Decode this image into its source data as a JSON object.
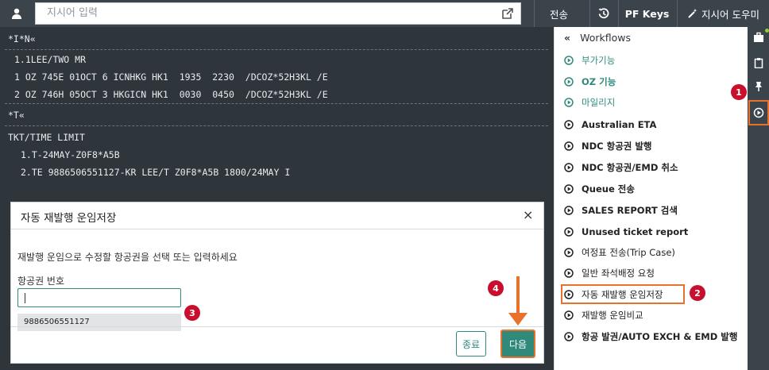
{
  "topbar": {
    "command_placeholder": "지시어 입력",
    "send_label": "전송",
    "pf_keys_label": "PF Keys",
    "help_label": "지시어 도우미"
  },
  "terminal": {
    "lines": [
      "*I*N«",
      "1.1LEE/TWO MR",
      "1 OZ 745E 01OCT 6 ICNHKG HK1  1935  2230  /DCOZ*52H3KL /E",
      "2 OZ 746H 05OCT 3 HKGICN HK1  0030  0450  /DCOZ*52H3KL /E",
      "*T«",
      "TKT/TIME LIMIT",
      "1.T-24MAY-Z0F8*A5B",
      "2.TE 9886506551127-KR LEE/T Z0F8*A5B 1800/24MAY I"
    ]
  },
  "dialog": {
    "title": "자동 재발행 운임저장",
    "instruction": "재발행 운임으로 수정할 항공권을 선택 또는 입력하세요",
    "field_label": "항공권 번호",
    "ticket_value": "",
    "suggestion": "9886506551127",
    "close_button": "종료",
    "next_button": "다음"
  },
  "workflows": {
    "header": "Workflows",
    "items": [
      {
        "label": "부가기능"
      },
      {
        "label": "OZ 기능"
      },
      {
        "label": "마일리지"
      },
      {
        "label": "Australian ETA"
      },
      {
        "label": "NDC 항공권 발행"
      },
      {
        "label": "NDC 항공권/EMD 취소"
      },
      {
        "label": "Queue 전송"
      },
      {
        "label": "SALES REPORT 검색"
      },
      {
        "label": "Unused ticket report"
      },
      {
        "label": "여정표 전송(Trip Case)"
      },
      {
        "label": "일반 좌석배정 요청"
      },
      {
        "label": "자동 재발행 운임저장"
      },
      {
        "label": "재발행 운임비교"
      },
      {
        "label": "항공 발권/AUTO EXCH & EMD 발행"
      }
    ]
  },
  "annotations": {
    "step1": "1",
    "step2": "2",
    "step3": "3",
    "step4": "4"
  },
  "colors": {
    "accent": "#2f8a7c",
    "highlight": "#e8722c",
    "badge": "#c8102e",
    "terminal_bg": "#2e353b",
    "toolbar_bg": "#3b434b"
  },
  "icons": {
    "user": "user-icon",
    "popout": "popout-icon",
    "history": "history-icon",
    "help": "wand-icon",
    "workflow_item": "play-circle-icon",
    "collapse": "double-chevron-left-icon",
    "rail": [
      "briefcase-icon",
      "clipboard-icon",
      "pin-icon",
      "play-circle-icon"
    ]
  }
}
